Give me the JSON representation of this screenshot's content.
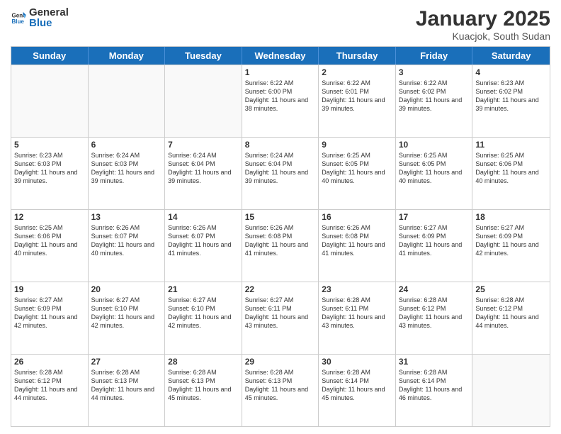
{
  "logo": {
    "general": "General",
    "blue": "Blue"
  },
  "title": "January 2025",
  "location": "Kuacjok, South Sudan",
  "days": [
    "Sunday",
    "Monday",
    "Tuesday",
    "Wednesday",
    "Thursday",
    "Friday",
    "Saturday"
  ],
  "weeks": [
    [
      {
        "day": "",
        "info": ""
      },
      {
        "day": "",
        "info": ""
      },
      {
        "day": "",
        "info": ""
      },
      {
        "day": "1",
        "info": "Sunrise: 6:22 AM\nSunset: 6:00 PM\nDaylight: 11 hours and 38 minutes."
      },
      {
        "day": "2",
        "info": "Sunrise: 6:22 AM\nSunset: 6:01 PM\nDaylight: 11 hours and 39 minutes."
      },
      {
        "day": "3",
        "info": "Sunrise: 6:22 AM\nSunset: 6:02 PM\nDaylight: 11 hours and 39 minutes."
      },
      {
        "day": "4",
        "info": "Sunrise: 6:23 AM\nSunset: 6:02 PM\nDaylight: 11 hours and 39 minutes."
      }
    ],
    [
      {
        "day": "5",
        "info": "Sunrise: 6:23 AM\nSunset: 6:03 PM\nDaylight: 11 hours and 39 minutes."
      },
      {
        "day": "6",
        "info": "Sunrise: 6:24 AM\nSunset: 6:03 PM\nDaylight: 11 hours and 39 minutes."
      },
      {
        "day": "7",
        "info": "Sunrise: 6:24 AM\nSunset: 6:04 PM\nDaylight: 11 hours and 39 minutes."
      },
      {
        "day": "8",
        "info": "Sunrise: 6:24 AM\nSunset: 6:04 PM\nDaylight: 11 hours and 39 minutes."
      },
      {
        "day": "9",
        "info": "Sunrise: 6:25 AM\nSunset: 6:05 PM\nDaylight: 11 hours and 40 minutes."
      },
      {
        "day": "10",
        "info": "Sunrise: 6:25 AM\nSunset: 6:05 PM\nDaylight: 11 hours and 40 minutes."
      },
      {
        "day": "11",
        "info": "Sunrise: 6:25 AM\nSunset: 6:06 PM\nDaylight: 11 hours and 40 minutes."
      }
    ],
    [
      {
        "day": "12",
        "info": "Sunrise: 6:25 AM\nSunset: 6:06 PM\nDaylight: 11 hours and 40 minutes."
      },
      {
        "day": "13",
        "info": "Sunrise: 6:26 AM\nSunset: 6:07 PM\nDaylight: 11 hours and 40 minutes."
      },
      {
        "day": "14",
        "info": "Sunrise: 6:26 AM\nSunset: 6:07 PM\nDaylight: 11 hours and 41 minutes."
      },
      {
        "day": "15",
        "info": "Sunrise: 6:26 AM\nSunset: 6:08 PM\nDaylight: 11 hours and 41 minutes."
      },
      {
        "day": "16",
        "info": "Sunrise: 6:26 AM\nSunset: 6:08 PM\nDaylight: 11 hours and 41 minutes."
      },
      {
        "day": "17",
        "info": "Sunrise: 6:27 AM\nSunset: 6:09 PM\nDaylight: 11 hours and 41 minutes."
      },
      {
        "day": "18",
        "info": "Sunrise: 6:27 AM\nSunset: 6:09 PM\nDaylight: 11 hours and 42 minutes."
      }
    ],
    [
      {
        "day": "19",
        "info": "Sunrise: 6:27 AM\nSunset: 6:09 PM\nDaylight: 11 hours and 42 minutes."
      },
      {
        "day": "20",
        "info": "Sunrise: 6:27 AM\nSunset: 6:10 PM\nDaylight: 11 hours and 42 minutes."
      },
      {
        "day": "21",
        "info": "Sunrise: 6:27 AM\nSunset: 6:10 PM\nDaylight: 11 hours and 42 minutes."
      },
      {
        "day": "22",
        "info": "Sunrise: 6:27 AM\nSunset: 6:11 PM\nDaylight: 11 hours and 43 minutes."
      },
      {
        "day": "23",
        "info": "Sunrise: 6:28 AM\nSunset: 6:11 PM\nDaylight: 11 hours and 43 minutes."
      },
      {
        "day": "24",
        "info": "Sunrise: 6:28 AM\nSunset: 6:12 PM\nDaylight: 11 hours and 43 minutes."
      },
      {
        "day": "25",
        "info": "Sunrise: 6:28 AM\nSunset: 6:12 PM\nDaylight: 11 hours and 44 minutes."
      }
    ],
    [
      {
        "day": "26",
        "info": "Sunrise: 6:28 AM\nSunset: 6:12 PM\nDaylight: 11 hours and 44 minutes."
      },
      {
        "day": "27",
        "info": "Sunrise: 6:28 AM\nSunset: 6:13 PM\nDaylight: 11 hours and 44 minutes."
      },
      {
        "day": "28",
        "info": "Sunrise: 6:28 AM\nSunset: 6:13 PM\nDaylight: 11 hours and 45 minutes."
      },
      {
        "day": "29",
        "info": "Sunrise: 6:28 AM\nSunset: 6:13 PM\nDaylight: 11 hours and 45 minutes."
      },
      {
        "day": "30",
        "info": "Sunrise: 6:28 AM\nSunset: 6:14 PM\nDaylight: 11 hours and 45 minutes."
      },
      {
        "day": "31",
        "info": "Sunrise: 6:28 AM\nSunset: 6:14 PM\nDaylight: 11 hours and 46 minutes."
      },
      {
        "day": "",
        "info": ""
      }
    ]
  ]
}
